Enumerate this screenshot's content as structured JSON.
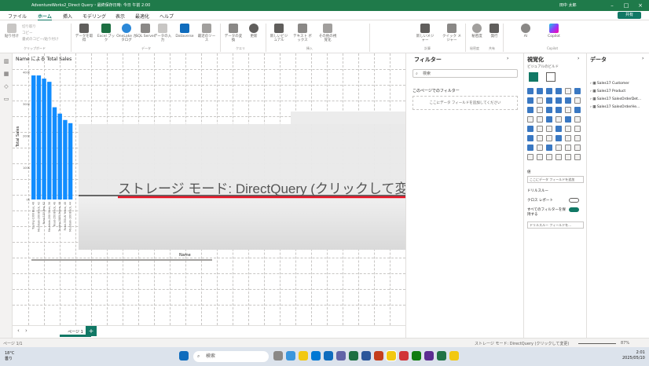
{
  "window": {
    "title": "AdventureWorks2_Direct Query・最終保存日時: 今日 午前 2:00",
    "user": "田中 太郎"
  },
  "menu": {
    "items": [
      "ファイル",
      "ホーム",
      "挿入",
      "モデリング",
      "表示",
      "最適化",
      "ヘルプ"
    ],
    "share": "共有"
  },
  "ribbon": {
    "buttons": [
      "データを取得",
      "Excel ブック",
      "OneLake カタログ",
      "SQL Server",
      "データの入力",
      "Dataverse",
      "最近のソース",
      "データの変換",
      "更新",
      "新しいビジュアル",
      "テキスト ボックス",
      "その他の視覚化",
      "新しいメジャー",
      "クイック メジャー",
      "秘密度",
      "発行",
      "AI",
      "Copilot"
    ],
    "groups": [
      "クリップボード",
      "データ",
      "クエリ",
      "挿入",
      "計算",
      "秘密度",
      "共有",
      "Copilot"
    ],
    "clipboard": [
      "貼り付け",
      "切り取り",
      "コピー",
      "書式のコピー/貼り付け"
    ]
  },
  "chart_data": {
    "type": "bar",
    "title": "Name による Total Sales",
    "xlabel": "Name",
    "ylabel": "Total Sales",
    "categories": [
      "Touring-1000 Blue, 46",
      "Mountain-200 Black, 42",
      "Road-150 Red, 62",
      "Mountain-200 Silver, 38",
      "Road-250 Black, 48",
      "Touring-1000 Yellow, 46",
      "Road-350-W Yellow, 48",
      "Mountain-100 Black, 44"
    ],
    "values": [
      390,
      390,
      380,
      370,
      290,
      270,
      250,
      240
    ],
    "ylim": [
      0,
      400
    ],
    "yticks": [
      "0K",
      "100K",
      "200K",
      "300K",
      "400K"
    ],
    "bar_color": "#118dff"
  },
  "overlay": {
    "banner": "ストレージ モード: DirectQuery (クリックして変更)",
    "arrow_color": "#e81123"
  },
  "filters": {
    "header": "フィルター",
    "search_placeholder": "検索",
    "page_label": "このページでのフィルター",
    "drop_hint": "ここにデータ フィールドを追加してください"
  },
  "viz": {
    "header": "視覚化",
    "build": "ビジュアルのビルド",
    "values_label": "値",
    "values_hint": "ここにデータ フィールドを追加",
    "drill_label": "ドリルスルー",
    "cross_report": "クロス レポート",
    "keep_filters": "すべてのフィルターを保持する",
    "drill_hint": "ドリルスルー フィールドを..."
  },
  "data": {
    "header": "データ",
    "tables": [
      "Sales17 Customer",
      "Sales17 Product",
      "Sales17 SalesOrderDet...",
      "Sales17 SalesOrderHe..."
    ]
  },
  "pages": {
    "tab": "ページ 1",
    "add": "+"
  },
  "status": {
    "page": "ページ 1/1",
    "mode": "ストレージ モード: DirectQuery (クリックして変更)",
    "zoom": "87%"
  },
  "taskbar": {
    "weather_temp": "18°C",
    "weather_desc": "曇り",
    "search": "検索",
    "time": "2:01",
    "date": "2025/05/10"
  }
}
